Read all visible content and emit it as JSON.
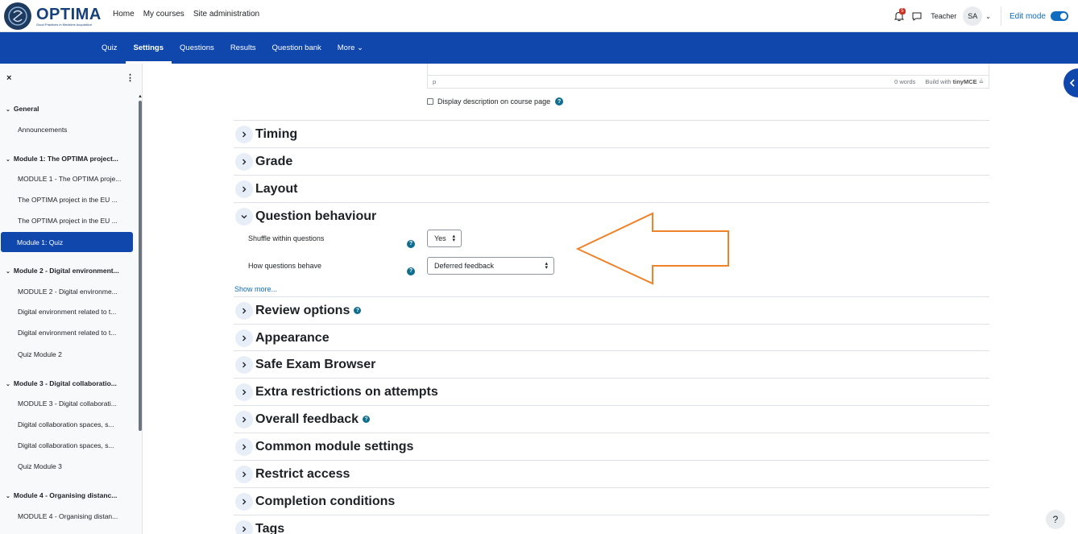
{
  "brand": {
    "title": "OPTIMA",
    "subtitle": "Good Practices in Medicine Acquisition"
  },
  "topnav": [
    "Home",
    "My courses",
    "Site administration"
  ],
  "user": {
    "notifications": "5",
    "role": "Teacher",
    "initials": "SA",
    "edit_mode": "Edit mode"
  },
  "secnav": [
    {
      "label": "Quiz",
      "active": false
    },
    {
      "label": "Settings",
      "active": true
    },
    {
      "label": "Questions",
      "active": false
    },
    {
      "label": "Results",
      "active": false
    },
    {
      "label": "Question bank",
      "active": false
    },
    {
      "label": "More ⌄",
      "active": false
    }
  ],
  "course_index": {
    "close": "×",
    "menu": "⋮",
    "entries": [
      {
        "type": "section",
        "label": "General"
      },
      {
        "type": "item",
        "label": "Announcements"
      },
      {
        "type": "section",
        "label": "Module 1: The OPTIMA project..."
      },
      {
        "type": "item",
        "label": "MODULE 1 - The OPTIMA proje..."
      },
      {
        "type": "item",
        "label": "The OPTIMA project in the EU ..."
      },
      {
        "type": "item",
        "label": "The OPTIMA project in the EU ..."
      },
      {
        "type": "current",
        "label": "Module 1: Quiz"
      },
      {
        "type": "section",
        "label": "Module 2 - Digital environment..."
      },
      {
        "type": "item",
        "label": "MODULE 2 - Digital environme..."
      },
      {
        "type": "item",
        "label": "Digital environment related to t..."
      },
      {
        "type": "item",
        "label": "Digital environment related to t..."
      },
      {
        "type": "item",
        "label": "Quiz Module 2"
      },
      {
        "type": "section",
        "label": "Module 3 - Digital collaboratio..."
      },
      {
        "type": "item",
        "label": "MODULE 3 - Digital collaborati..."
      },
      {
        "type": "item",
        "label": "Digital collaboration spaces, s..."
      },
      {
        "type": "item",
        "label": "Digital collaboration spaces, s..."
      },
      {
        "type": "item",
        "label": "Quiz Module 3"
      },
      {
        "type": "section",
        "label": "Module 4 - Organising distanc..."
      },
      {
        "type": "item",
        "label": "MODULE 4 - Organising distan..."
      }
    ]
  },
  "editor": {
    "path": "p",
    "words": "0 words",
    "built_with": "Build with",
    "tiny": "tinyMCE"
  },
  "display_description": "Display description on course page",
  "sections": [
    {
      "title": "Timing",
      "expanded": false,
      "help": false
    },
    {
      "title": "Grade",
      "expanded": false,
      "help": false
    },
    {
      "title": "Layout",
      "expanded": false,
      "help": false
    },
    {
      "title": "Question behaviour",
      "expanded": true,
      "help": false
    },
    {
      "title": "Review options",
      "expanded": false,
      "help": true
    },
    {
      "title": "Appearance",
      "expanded": false,
      "help": false
    },
    {
      "title": "Safe Exam Browser",
      "expanded": false,
      "help": false
    },
    {
      "title": "Extra restrictions on attempts",
      "expanded": false,
      "help": false
    },
    {
      "title": "Overall feedback",
      "expanded": false,
      "help": true
    },
    {
      "title": "Common module settings",
      "expanded": false,
      "help": false
    },
    {
      "title": "Restrict access",
      "expanded": false,
      "help": false
    },
    {
      "title": "Completion conditions",
      "expanded": false,
      "help": false
    },
    {
      "title": "Tags",
      "expanded": false,
      "help": false
    }
  ],
  "question_behaviour": {
    "shuffle_label": "Shuffle within questions",
    "shuffle_value": "Yes",
    "behave_label": "How questions behave",
    "behave_value": "Deferred feedback",
    "show_more": "Show more..."
  },
  "colors": {
    "primary": "#0f47ad",
    "annotation_arrow": "#f0832a",
    "help": "#0f6e8f"
  },
  "help_button": "?"
}
